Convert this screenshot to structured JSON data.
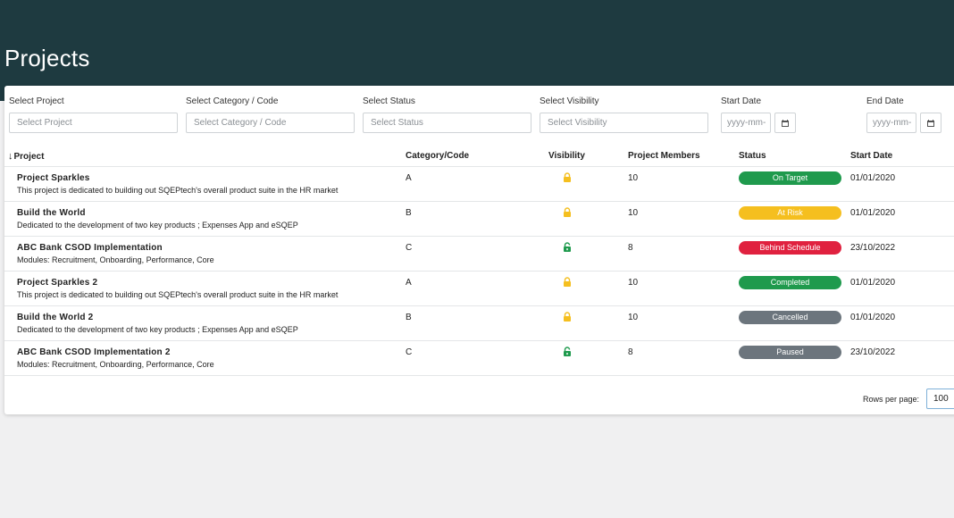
{
  "page": {
    "title": "Projects"
  },
  "filters": {
    "project": {
      "label": "Select Project",
      "placeholder": "Select Project"
    },
    "category": {
      "label": "Select Category / Code",
      "placeholder": "Select Category / Code"
    },
    "status": {
      "label": "Select Status",
      "placeholder": "Select Status"
    },
    "visibility": {
      "label": "Select Visibility",
      "placeholder": "Select Visibility"
    },
    "start_date": {
      "label": "Start Date",
      "placeholder": "yyyy-mm-"
    },
    "end_date": {
      "label": "End Date",
      "placeholder": "yyyy-mm-"
    }
  },
  "table": {
    "sort_icon": "arrow-down-icon",
    "columns": {
      "project": "Project",
      "category": "Category/Code",
      "visibility": "Visibility",
      "members": "Project Members",
      "status": "Status",
      "start_date": "Start Date"
    },
    "rows": [
      {
        "name": "Project Sparkles",
        "description": "This project is dedicated to building out SQEPtech's overall product suite in the HR market",
        "category": "A",
        "visibility_icon": "lock-closed-icon",
        "members": "10",
        "status": "On Target",
        "status_color": "#1f9a4d",
        "start_date": "01/01/2020"
      },
      {
        "name": "Build the World",
        "description": "Dedicated to the development of two key products ; Expenses App and eSQEP",
        "category": "B",
        "visibility_icon": "lock-closed-icon",
        "members": "10",
        "status": "At Risk",
        "status_color": "#f5bf1f",
        "start_date": "01/01/2020"
      },
      {
        "name": "ABC Bank CSOD Implementation",
        "description": "Modules: Recruitment, Onboarding, Performance, Core",
        "category": "C",
        "visibility_icon": "lock-open-icon",
        "members": "8",
        "status": "Behind Schedule",
        "status_color": "#e0213f",
        "start_date": "23/10/2022"
      },
      {
        "name": "Project Sparkles 2",
        "description": "This project is dedicated to building out SQEPtech's overall product suite in the HR market",
        "category": "A",
        "visibility_icon": "lock-closed-icon",
        "members": "10",
        "status": "Completed",
        "status_color": "#1f9a4d",
        "start_date": "01/01/2020"
      },
      {
        "name": "Build the World 2",
        "description": "Dedicated to the development of two key products ; Expenses App and eSQEP",
        "category": "B",
        "visibility_icon": "lock-closed-icon",
        "members": "10",
        "status": "Cancelled",
        "status_color": "#6c757d",
        "start_date": "01/01/2020"
      },
      {
        "name": "ABC Bank CSOD Implementation 2",
        "description": "Modules: Recruitment, Onboarding, Performance, Core",
        "category": "C",
        "visibility_icon": "lock-open-icon",
        "members": "8",
        "status": "Paused",
        "status_color": "#6c757d",
        "start_date": "23/10/2022"
      }
    ]
  },
  "footer": {
    "rows_per_page_label": "Rows per page:",
    "rows_per_page_value": "100"
  },
  "colors": {
    "header_bg": "#1e3a40",
    "lock_closed": "#f5bf1f",
    "lock_open": "#1f9a4d"
  }
}
